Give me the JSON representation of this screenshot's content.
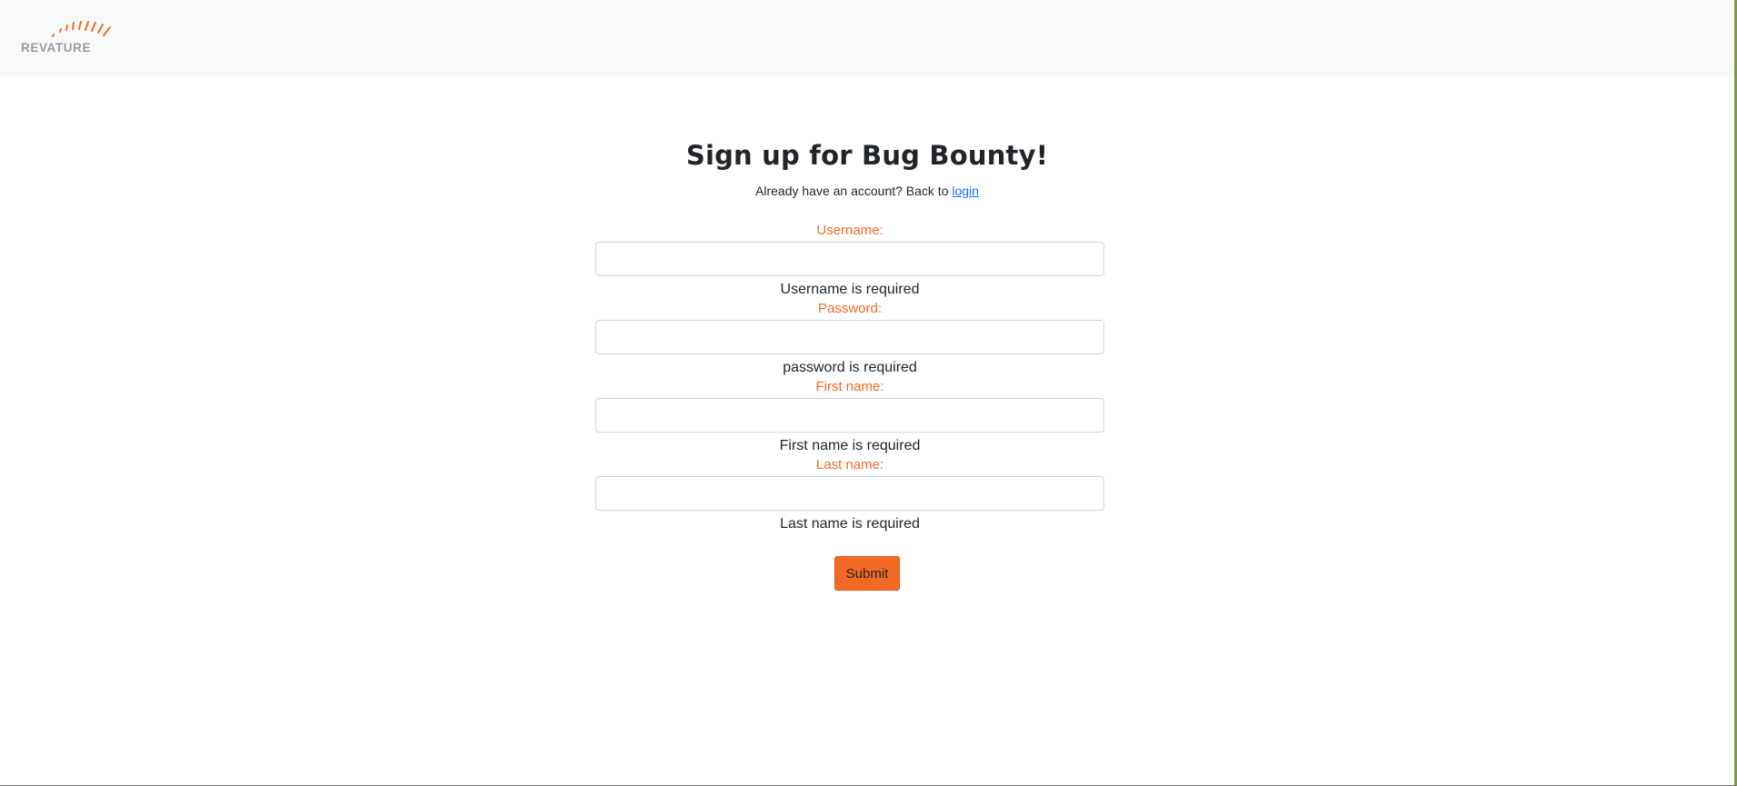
{
  "brand": {
    "name": "REVATURE",
    "accent": "#f26925"
  },
  "header": {
    "title": "Sign up for Bug Bounty!",
    "subtitle_prefix": "Already have an account? Back to ",
    "login_link": "login"
  },
  "form": {
    "fields": [
      {
        "label": "Username:",
        "value": "",
        "error": "Username is required"
      },
      {
        "label": "Password:",
        "value": "",
        "error": "password is required"
      },
      {
        "label": "First name:",
        "value": "",
        "error": "First name is required"
      },
      {
        "label": "Last name:",
        "value": "",
        "error": "Last name is required"
      }
    ],
    "submit_label": "Submit"
  },
  "colors": {
    "label": "#f26925",
    "button": "#f26925",
    "link": "#0d6efd",
    "navbar_bg": "#f8f9fa"
  }
}
